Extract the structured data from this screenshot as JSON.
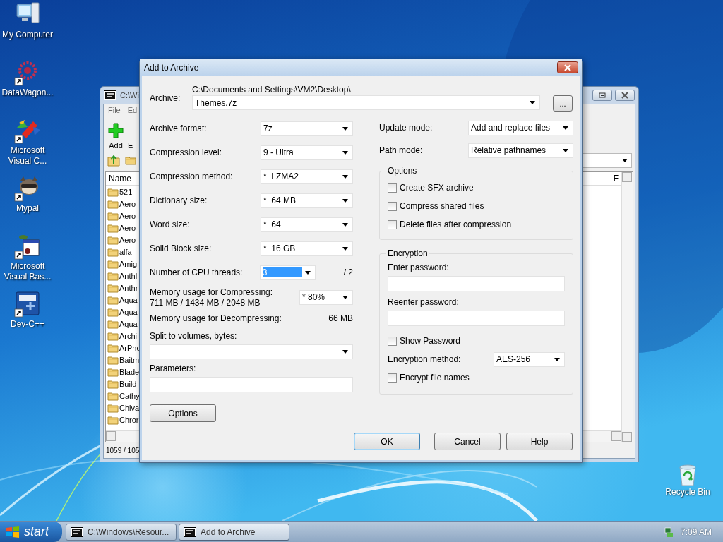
{
  "desktop_icons": [
    {
      "label": "My Computer",
      "kind": "computer",
      "shortcut": false
    },
    {
      "label": "DataWagon...",
      "kind": "flower",
      "shortcut": true
    },
    {
      "label": "Microsoft Visual C...",
      "kind": "ribbon",
      "shortcut": true
    },
    {
      "label": "Mypal",
      "kind": "raccoon",
      "shortcut": true
    },
    {
      "label": "Microsoft Visual Bas...",
      "kind": "card",
      "shortcut": true
    },
    {
      "label": "Dev-C++",
      "kind": "tile",
      "shortcut": true
    }
  ],
  "recycle_bin": {
    "label": "Recycle Bin"
  },
  "background_window": {
    "title": "C:\\Wi",
    "menu": [
      "File",
      "Ed"
    ],
    "toolbar": [
      "Add",
      "E"
    ],
    "columns": [
      "Name",
      "F"
    ],
    "files": [
      "521",
      "Aero",
      "Aero",
      "Aero",
      "Aero",
      "alfa",
      "Amig",
      "Anthl",
      "Anthr",
      "Aqua",
      "Aqua",
      "Aqua",
      "Archi",
      "ArPho",
      "Baitm",
      "Blade",
      "Build",
      "Cathy",
      "Chiva",
      "Chror"
    ],
    "status": "1059 / 105"
  },
  "dialog": {
    "title": "Add to Archive",
    "archive": {
      "label": "Archive:",
      "path": "C:\\Documents and Settings\\VM2\\Desktop\\",
      "value": "Themes.7z",
      "browse": "..."
    },
    "left_rows": [
      {
        "kind": "combo",
        "label": "Archive format:",
        "value": "7z"
      },
      {
        "kind": "combo",
        "label": "Compression level:",
        "value": "9 - Ultra"
      },
      {
        "kind": "combo",
        "label": "Compression method:",
        "value": "*  LZMA2"
      },
      {
        "kind": "combo",
        "label": "Dictionary size:",
        "value": "*  64 MB"
      },
      {
        "kind": "combo",
        "label": "Word size:",
        "value": "*  64"
      },
      {
        "kind": "combo",
        "label": "Solid Block size:",
        "value": "*  16 GB"
      },
      {
        "kind": "threads",
        "label": "Number of CPU threads:",
        "value": "3",
        "highlighted": true,
        "suffix": "/ 2"
      },
      {
        "kind": "memory",
        "label": "Memory usage for Compressing:",
        "detail": "711 MB / 1434 MB / 2048 MB",
        "value": "* 80%"
      },
      {
        "kind": "readout",
        "label": "Memory usage for Decompressing:",
        "value": "66 MB"
      },
      {
        "kind": "wide_combo",
        "label": "Split to volumes, bytes:"
      },
      {
        "kind": "wide_input",
        "label": "Parameters:"
      }
    ],
    "options_button": "Options",
    "right_rows": [
      {
        "label": "Update mode:",
        "value": "Add and replace files"
      },
      {
        "label": "Path mode:",
        "value": "Relative pathnames"
      }
    ],
    "options_group": {
      "title": "Options",
      "checkboxes": [
        {
          "label": "Create SFX archive",
          "checked": false
        },
        {
          "label": "Compress shared files",
          "checked": false
        },
        {
          "label": "Delete files after compression",
          "checked": false
        }
      ]
    },
    "encryption": {
      "title": "Encryption",
      "enter_password": "Enter password:",
      "reenter_password": "Reenter password:",
      "show_password": {
        "label": "Show Password",
        "checked": false
      },
      "method": {
        "label": "Encryption method:",
        "value": "AES-256"
      },
      "encrypt_names": {
        "label": "Encrypt file names",
        "checked": false
      }
    },
    "buttons": [
      {
        "label": "OK",
        "focused": true
      },
      {
        "label": "Cancel",
        "focused": false
      },
      {
        "label": "Help",
        "focused": false
      }
    ]
  },
  "taskbar": {
    "start": "start",
    "tasks": [
      {
        "label": "C:\\Windows\\Resour...",
        "selected": false
      },
      {
        "label": "Add to Archive",
        "selected": true
      }
    ],
    "clock": "7:09 AM"
  }
}
